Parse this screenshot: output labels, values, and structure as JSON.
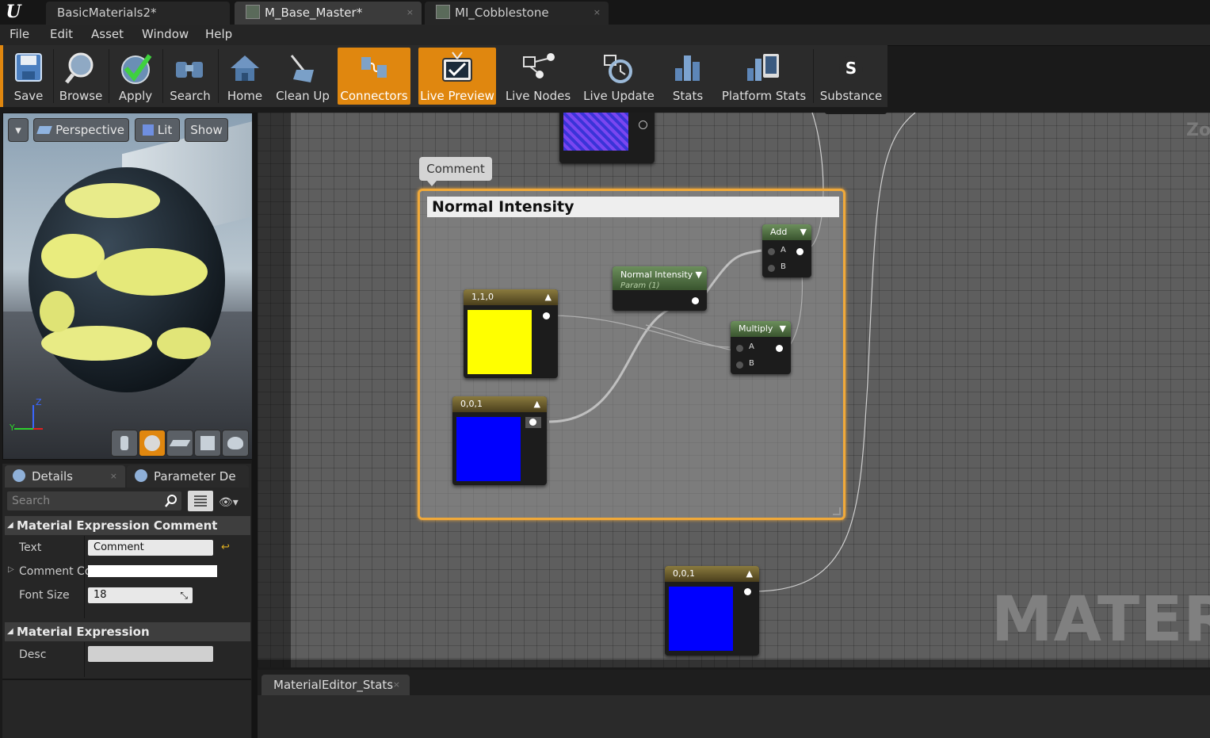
{
  "tabs": [
    {
      "label": "BasicMaterials2*"
    },
    {
      "label": "M_Base_Master*"
    },
    {
      "label": "MI_Cobblestone"
    }
  ],
  "menu": [
    "File",
    "Edit",
    "Asset",
    "Window",
    "Help"
  ],
  "toolbar": {
    "items": [
      {
        "label": "Save",
        "icon": "save-icon"
      },
      {
        "label": "Browse",
        "icon": "browse-icon"
      },
      {
        "label": "Apply",
        "icon": "apply-icon"
      },
      {
        "label": "Search",
        "icon": "search-icon"
      },
      {
        "label": "Home",
        "icon": "home-icon"
      },
      {
        "label": "Clean Up",
        "icon": "clean-up-icon"
      },
      {
        "label": "Connectors",
        "icon": "connectors-icon",
        "active": true
      },
      {
        "label": "Live Preview",
        "icon": "live-preview-icon",
        "active": true
      },
      {
        "label": "Live Nodes",
        "icon": "live-nodes-icon"
      },
      {
        "label": "Live Update",
        "icon": "live-update-icon"
      },
      {
        "label": "Stats",
        "icon": "stats-icon"
      },
      {
        "label": "Platform Stats",
        "icon": "platform-stats-icon"
      },
      {
        "label": "Substance",
        "icon": "substance-icon"
      }
    ],
    "active_color": "#e0870f"
  },
  "viewport": {
    "perspective": "Perspective",
    "lit": "Lit",
    "show": "Show",
    "axis_z": "Z",
    "axis_y": "Y"
  },
  "details": {
    "tab_details": "Details",
    "tab_params": "Parameter De",
    "search_placeholder": "Search",
    "section1": "Material Expression Comment",
    "text_label": "Text",
    "text_value": "Comment",
    "comment_color_label": "Comment Co",
    "font_size_label": "Font Size",
    "font_size_value": "18",
    "section2": "Material Expression",
    "desc_label": "Desc",
    "desc_value": ""
  },
  "graph": {
    "comment_bubble": "Comment",
    "comment_title": "Normal Intensity",
    "node_yellow": "1,1,0",
    "node_blue1": "0,0,1",
    "node_blue2": "0,0,1",
    "param_title": "Normal Intensity",
    "param_sub": "Param (1)",
    "add_title": "Add",
    "multiply_title": "Multiply",
    "pin_a": "A",
    "pin_b": "B",
    "zoom_text": "Zo",
    "watermark": "MATERIA",
    "colors": {
      "yellow": "#ffff00",
      "blue": "#0000ff",
      "comment_border": "#f0a93a"
    }
  },
  "bottom_tab": "MaterialEditor_Stats"
}
